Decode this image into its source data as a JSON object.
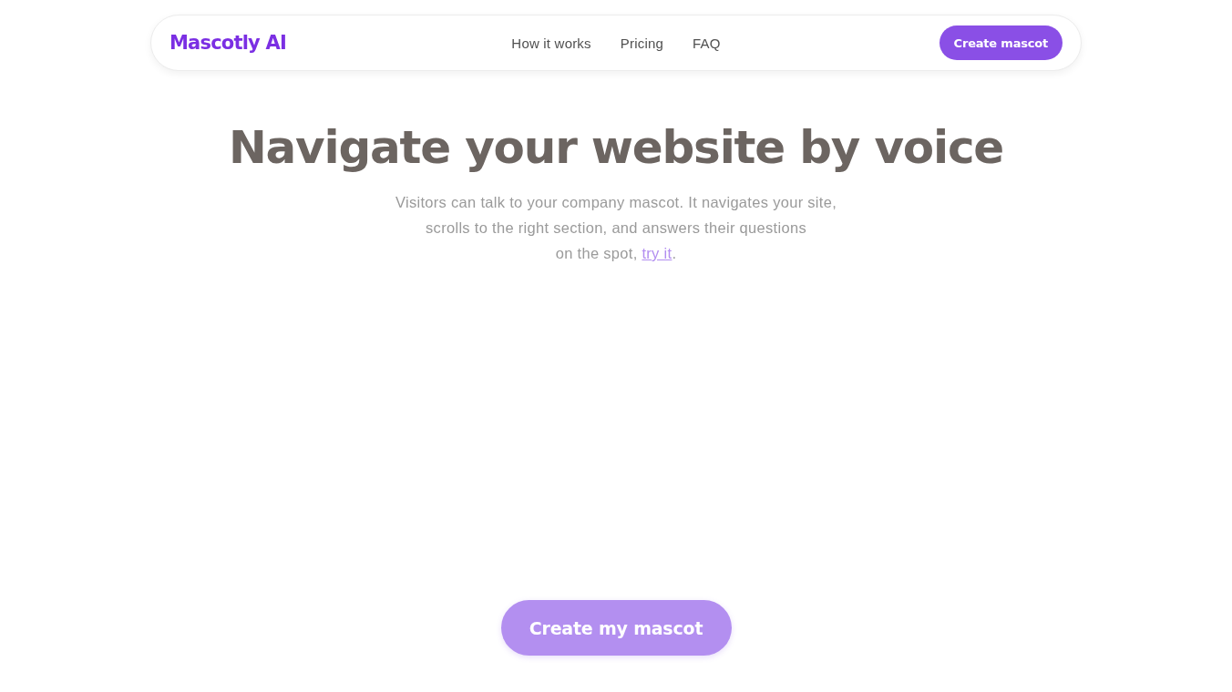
{
  "header": {
    "logo": "Mascotly AI",
    "nav_links": [
      "How it works",
      "Pricing",
      "FAQ"
    ],
    "cta_button": "Create mascot"
  },
  "hero": {
    "title": "Navigate your website by voice",
    "description": {
      "text": "Visitors can talk to your company mascot. It navigates your site,\nscrolls to the right section, and answers their questions\non the spot, ",
      "link": "try it",
      "after": "."
    },
    "cta_button": "Create my mascot"
  }
}
